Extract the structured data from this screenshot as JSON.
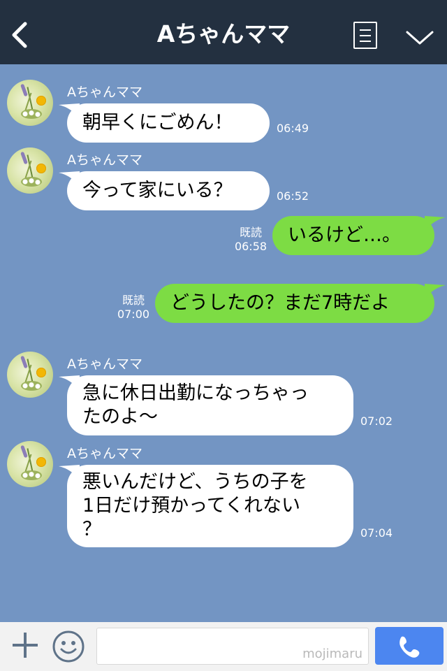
{
  "header": {
    "title": "Aちゃんママ"
  },
  "messages": [
    {
      "type": "in",
      "name": "Aちゃんママ",
      "text": "朝早くにごめん！",
      "time": "06:49"
    },
    {
      "type": "in",
      "name": "Aちゃんママ",
      "text": "今って家にいる？",
      "time": "06:52"
    },
    {
      "type": "out",
      "read": "既読",
      "time": "06:58",
      "text": "いるけど…。"
    },
    {
      "type": "out",
      "read": "既読",
      "time": "07:00",
      "text": "どうしたの？まだ7時だよ"
    },
    {
      "type": "in",
      "name": "Aちゃんママ",
      "text": "急に休日出勤になっちゃっ\nたのよ〜",
      "time": "07:02"
    },
    {
      "type": "in",
      "name": "Aちゃんママ",
      "text": "悪いんだけど、うちの子を\n1日だけ預かってくれない\n？",
      "time": "07:04"
    }
  ],
  "footer": {
    "watermark": "mojimaru"
  },
  "colors": {
    "header": "#233040",
    "chat_bg": "#7395c3",
    "outgoing": "#7ddc44",
    "incoming": "#ffffff",
    "call": "#4c86f0"
  },
  "icons": [
    "back-icon",
    "menu-icon",
    "chevron-down-icon",
    "plus-icon",
    "emoji-icon",
    "phone-icon"
  ]
}
